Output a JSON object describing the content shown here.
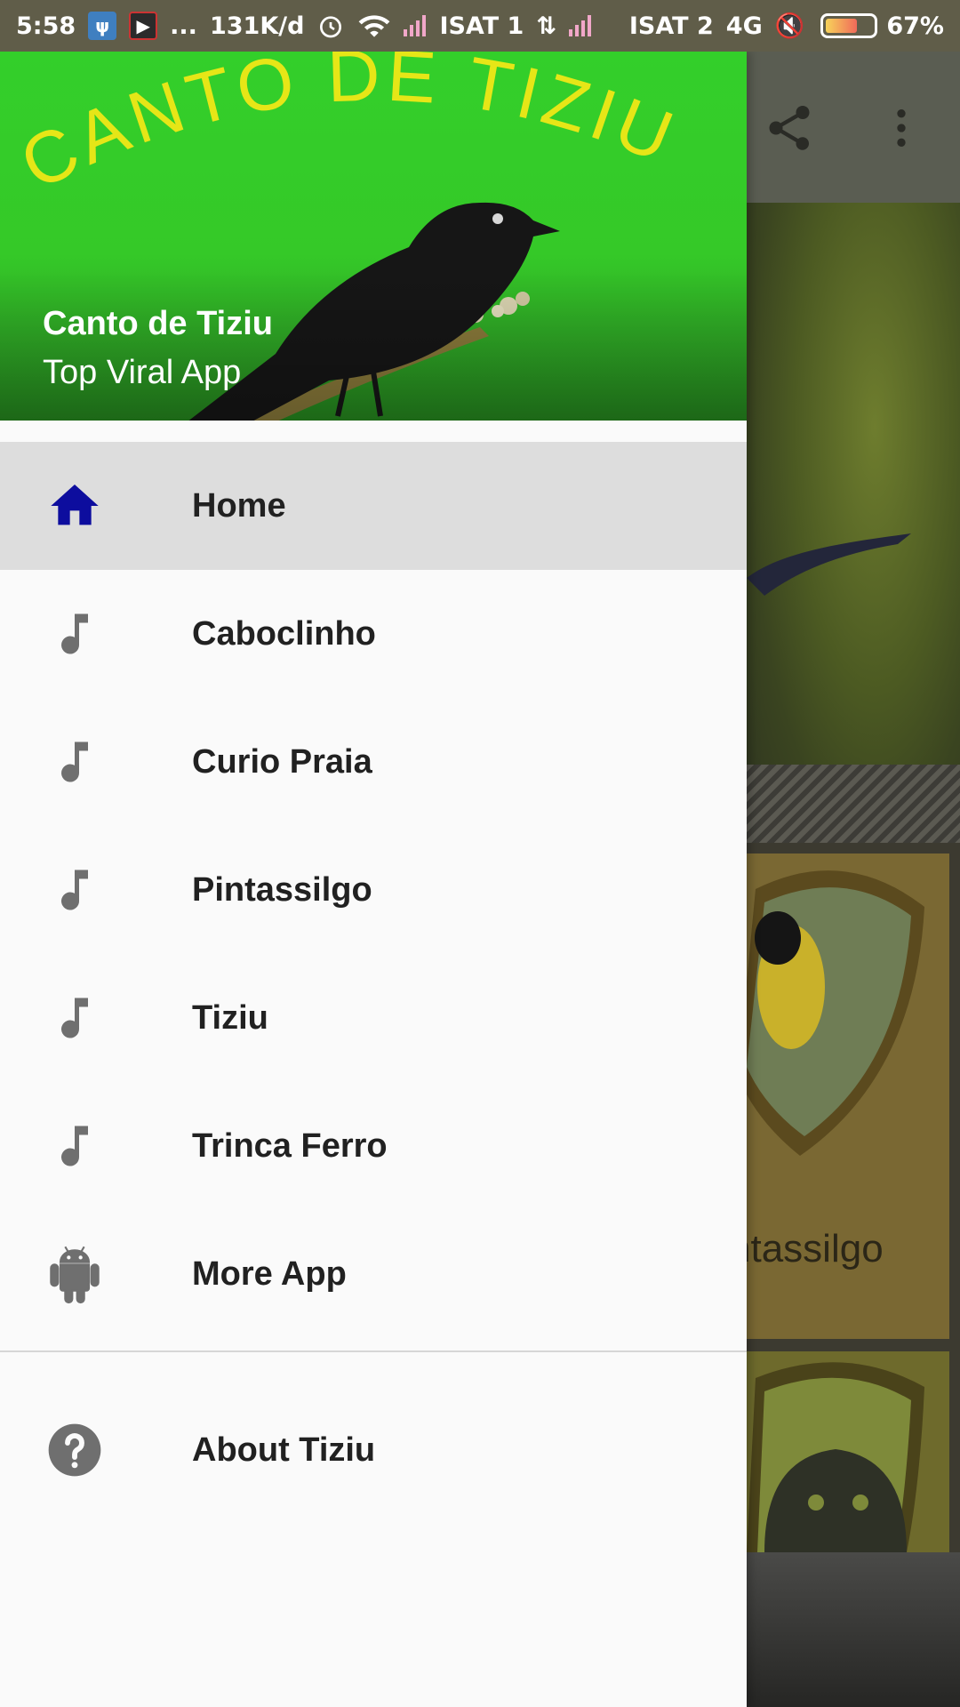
{
  "status_bar": {
    "time": "5:58",
    "dots": "...",
    "net_speed": "131K/d",
    "carrier1": "ISAT 1",
    "carrier2": "ISAT 2",
    "network_type": "4G",
    "battery": "67%",
    "icons": [
      "usb-icon",
      "screen-record-icon",
      "alarm-icon",
      "wifi-icon",
      "signal-icon",
      "data-arrows-icon",
      "signal-icon",
      "mute-icon",
      "battery-icon"
    ]
  },
  "drawer": {
    "header": {
      "banner_text": "CANTO DE TIZIU",
      "app_name": "Canto de Tiziu",
      "tagline": "Top Viral App"
    },
    "items": [
      {
        "label": "Home",
        "icon": "home-icon",
        "active": true
      },
      {
        "label": "Caboclinho",
        "icon": "music-note-icon"
      },
      {
        "label": "Curio Praia",
        "icon": "music-note-icon"
      },
      {
        "label": "Pintassilgo",
        "icon": "music-note-icon"
      },
      {
        "label": "Tiziu",
        "icon": "music-note-icon"
      },
      {
        "label": "Trinca Ferro",
        "icon": "music-note-icon"
      },
      {
        "label": "More App",
        "icon": "android-icon"
      }
    ],
    "secondary_items": [
      {
        "label": "About Tiziu",
        "icon": "help-icon"
      }
    ]
  },
  "background": {
    "card_label": "ntassilgo",
    "toolbar_icons": [
      "share-icon",
      "more-vert-icon"
    ]
  },
  "colors": {
    "header_green": "#33cf2a",
    "home_icon": "#0d0d9e",
    "menu_icon": "#6f6f6f",
    "active_row": "#dddddd"
  }
}
